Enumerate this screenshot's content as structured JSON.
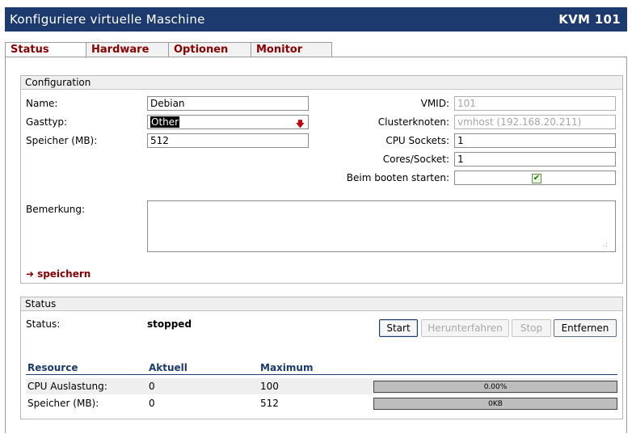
{
  "header": {
    "title": "Konfiguriere virtuelle Maschine",
    "vm_label": "KVM 101"
  },
  "tabs": [
    {
      "label": "Status",
      "active": true
    },
    {
      "label": "Hardware",
      "active": false
    },
    {
      "label": "Optionen",
      "active": false
    },
    {
      "label": "Monitor",
      "active": false
    }
  ],
  "configuration": {
    "legend": "Configuration",
    "name_label": "Name:",
    "name_value": "Debian",
    "gasttyp_label": "Gasttyp:",
    "gasttyp_value": "Other",
    "speicher_label": "Speicher (MB):",
    "speicher_value": "512",
    "vmid_label": "VMID:",
    "vmid_value": "101",
    "cluster_label": "Clusterknoten:",
    "cluster_value": "vmhost (192.168.20.211)",
    "cpu_sockets_label": "CPU Sockets:",
    "cpu_sockets_value": "1",
    "cores_label": "Cores/Socket:",
    "cores_value": "1",
    "boot_label": "Beim booten starten:",
    "boot_checked": true,
    "bemerkung_label": "Bemerkung:",
    "bemerkung_value": "",
    "save_label": "speichern"
  },
  "status": {
    "legend": "Status",
    "status_label": "Status:",
    "status_value": "stopped",
    "buttons": {
      "start": "Start",
      "shutdown": "Herunterfahren",
      "stop": "Stop",
      "remove": "Entfernen"
    },
    "table": {
      "headers": [
        "Resource",
        "Aktuell",
        "Maximum"
      ],
      "rows": [
        {
          "resource": "CPU Auslastung:",
          "aktuell": "0",
          "maximum": "100",
          "bar_text": "0.00%",
          "fraction": 0.0
        },
        {
          "resource": "Speicher (MB):",
          "aktuell": "0",
          "maximum": "512",
          "bar_text": "0KB",
          "fraction": 0.0
        }
      ]
    }
  },
  "colors": {
    "header_bg": "#1c3a6e",
    "tab_text": "#8b0000",
    "table_header": "#1c3a6e"
  },
  "icons": {
    "select_arrow": "arrow-down-icon",
    "save_arrow": "arrow-right-icon",
    "checkbox": "checkmark-icon",
    "resize": "resize-grip-icon"
  }
}
